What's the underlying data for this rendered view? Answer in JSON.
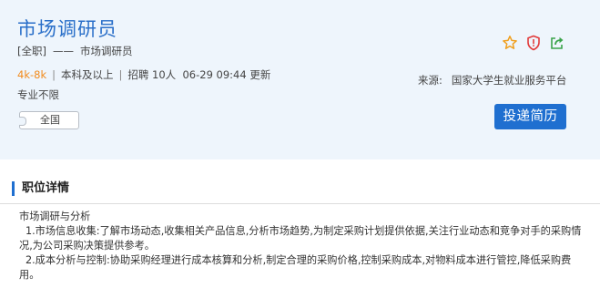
{
  "job": {
    "title": "市场调研员",
    "type": "[全职]",
    "type_sep": "——",
    "category": "市场调研员",
    "salary": "4k-8k",
    "education": "本科及以上",
    "hiring": "招聘 10人",
    "updated": "06-29 09:44 更新",
    "major": "专业不限",
    "region": "全国"
  },
  "source": {
    "label": "来源:",
    "value": "国家大学生就业服务平台"
  },
  "actions": {
    "apply_label": "投递简历",
    "icons": [
      "star-icon",
      "report-shield-icon",
      "share-icon"
    ]
  },
  "section": {
    "title": "职位详情"
  },
  "description": {
    "heading": "市场调研与分析",
    "items": [
      "1.市场信息收集:了解市场动态,收集相关产品信息,分析市场趋势,为制定采购计划提供依据,关注行业动态和竞争对手的采购情况,为公司采购决策提供参考。",
      "2.成本分析与控制:协助采购经理进行成本核算和分析,制定合理的采购价格,控制采购成本,对物料成本进行管控,降低采购费用。"
    ]
  },
  "colors": {
    "accent": "#1f6fd0",
    "title": "#2a6fc9",
    "salary": "#f28b1c",
    "header_bg": "#eef5fc",
    "star": "#f0a020",
    "report": "#e23b3b",
    "share": "#3aa34a"
  }
}
